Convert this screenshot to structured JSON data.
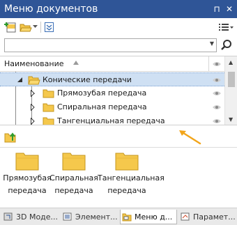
{
  "window": {
    "title": "Меню документов",
    "pin_glyph": "⊓",
    "close_glyph": "✕"
  },
  "toolbar": {
    "icons": [
      "new-document-icon",
      "open-folder-icon",
      "dropdown-arrow-icon",
      "collapse-icon",
      "list-view-icon"
    ]
  },
  "search": {
    "value": "",
    "placeholder": "",
    "dropdown_glyph": "▼",
    "button_icon": "search-icon"
  },
  "tree": {
    "column_header": "Наименование",
    "visibility_icon": "eye-icon",
    "rows": [
      {
        "label": "Конические передачи",
        "selected": true,
        "level": 1,
        "expanded": true
      },
      {
        "label": "Прямозубая передача",
        "selected": false,
        "level": 2,
        "expanded": false
      },
      {
        "label": "Спиральная передача",
        "selected": false,
        "level": 2,
        "expanded": false
      },
      {
        "label": "Тангенциальная передача",
        "selected": false,
        "level": 2,
        "expanded": false
      }
    ]
  },
  "preview": {
    "up_icon": "up-level-icon",
    "items": [
      {
        "label_line1": "Прямозубая",
        "label_line2": "передача"
      },
      {
        "label_line1": "Спиральная",
        "label_line2": "передача"
      },
      {
        "label_line1": "Тангенциальная",
        "label_line2": "передача"
      }
    ]
  },
  "tabs": [
    {
      "label": "3D Моде...",
      "icon": "3d-model-icon",
      "active": false
    },
    {
      "label": "Элемент...",
      "icon": "elements-icon",
      "active": false
    },
    {
      "label": "Меню д...",
      "icon": "document-menu-icon",
      "active": true
    },
    {
      "label": "Парамет...",
      "icon": "parameters-icon",
      "active": false
    }
  ],
  "colors": {
    "titlebar": "#2f5597",
    "selection": "#cfe0f3",
    "folder": "#f5c84c",
    "annotation_arrow": "#f2a51a"
  }
}
